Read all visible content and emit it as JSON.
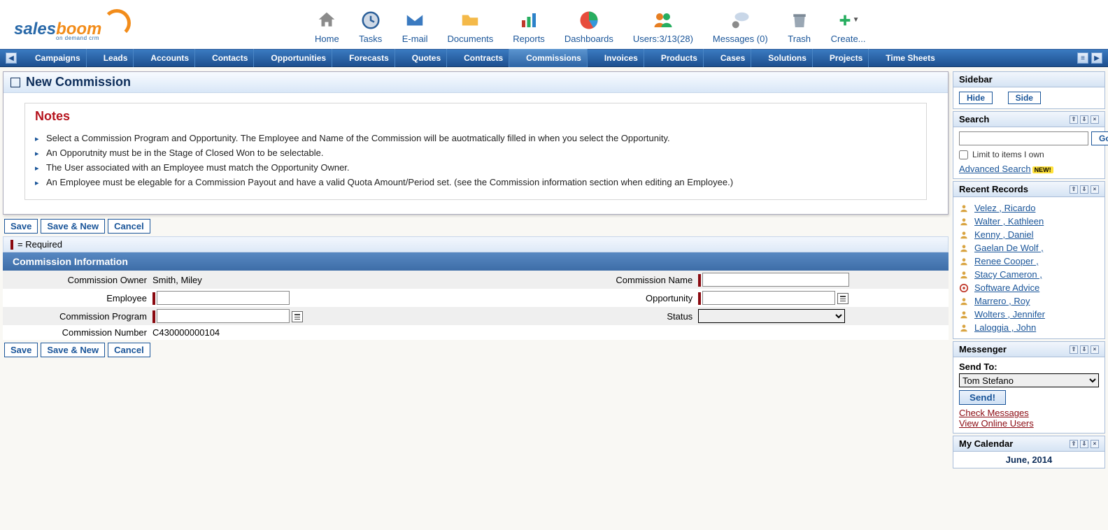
{
  "brand": {
    "sales": "sales",
    "boom": "boom",
    "tag": "on demand crm"
  },
  "topnav": [
    {
      "label": "Home"
    },
    {
      "label": "Tasks"
    },
    {
      "label": "E-mail"
    },
    {
      "label": "Documents"
    },
    {
      "label": "Reports"
    },
    {
      "label": "Dashboards"
    },
    {
      "label": "Users:3/13(28)"
    },
    {
      "label": "Messages (0)"
    },
    {
      "label": "Trash"
    },
    {
      "label": "Create..."
    }
  ],
  "tabs": [
    "Campaigns",
    "Leads",
    "Accounts",
    "Contacts",
    "Opportunities",
    "Forecasts",
    "Quotes",
    "Contracts",
    "Commissions",
    "Invoices",
    "Products",
    "Cases",
    "Solutions",
    "Projects",
    "Time Sheets"
  ],
  "active_tab": "Commissions",
  "page_title": "New Commission",
  "notes_title": "Notes",
  "notes": [
    "Select a Commission Program and Opportunity. The Employee and Name of the Commission will be auotmatically filled in when you select the Opportunity.",
    "An Opporutnity must be in the Stage of Closed Won to be selectable.",
    "The User associated with an Employee must match the Opportunity Owner.",
    "An Employee must be elegable for a Commission Payout and have a valid Quota Amount/Period set. (see the Commission information section when editing an Employee.)"
  ],
  "buttons": {
    "save": "Save",
    "save_new": "Save & New",
    "cancel": "Cancel"
  },
  "required_text": "= Required",
  "section_header": "Commission Information",
  "form": {
    "owner_label": "Commission Owner",
    "owner_value": "Smith, Miley",
    "name_label": "Commission Name",
    "name_value": "",
    "employee_label": "Employee",
    "employee_value": "",
    "opportunity_label": "Opportunity",
    "opportunity_value": "",
    "program_label": "Commission Program",
    "program_value": "",
    "status_label": "Status",
    "status_value": "",
    "number_label": "Commission Number",
    "number_value": "C430000000104"
  },
  "sidebar": {
    "title": "Sidebar",
    "hide": "Hide",
    "side": "Side",
    "search": {
      "title": "Search",
      "go": "Go",
      "limit": "Limit to items I own",
      "advanced": "Advanced Search",
      "new": "NEW!"
    },
    "recent": {
      "title": "Recent Records",
      "items": [
        "Velez , Ricardo",
        "Walter , Kathleen",
        "Kenny , Daniel",
        "Gaelan De Wolf ,",
        "Renee Cooper ,",
        "Stacy Cameron ,",
        "Software Advice",
        "Marrero , Roy",
        "Wolters , Jennifer",
        "Laloggia , John"
      ]
    },
    "messenger": {
      "title": "Messenger",
      "send_to": "Send To:",
      "selected": "Tom Stefano",
      "send": "Send!",
      "check": "Check Messages",
      "online": "View Online Users"
    },
    "calendar": {
      "title": "My Calendar",
      "month": "June, 2014"
    }
  }
}
